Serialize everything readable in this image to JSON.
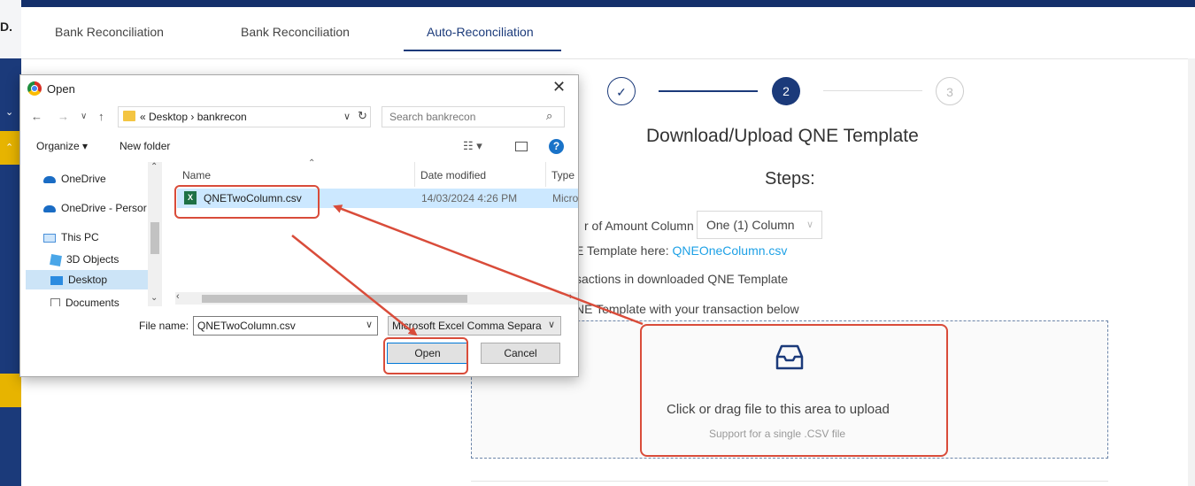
{
  "app": {
    "brand_initial": "D."
  },
  "tabs": [
    {
      "label": "Bank Reconciliation"
    },
    {
      "label": "Bank Reconciliation"
    },
    {
      "label": "Auto-Reconciliation"
    }
  ],
  "stepper": {
    "step2": "2",
    "step3": "3"
  },
  "main": {
    "heading": "Download/Upload QNE Template",
    "steps_label": "Steps:",
    "line1": "r of Amount Column",
    "select_value": "One (1) Column",
    "line2_prefix": "E Template here: ",
    "line2_link": "QNEOneColumn.csv",
    "line3": "sactions in downloaded QNE Template",
    "line4": "NE Template with your transaction below",
    "upload_text": "Click or drag file to this area to upload",
    "upload_hint": "Support for a single .CSV file"
  },
  "dialog": {
    "title": "Open",
    "address": "« Desktop › bankrecon",
    "search_placeholder": "Search bankrecon",
    "organize_label": "Organize ▾",
    "new_folder_label": "New folder",
    "nav_items": [
      {
        "label": "OneDrive"
      },
      {
        "label": "OneDrive - Persor"
      },
      {
        "label": "This PC"
      },
      {
        "label": "3D Objects"
      },
      {
        "label": "Desktop"
      },
      {
        "label": "Documents"
      }
    ],
    "columns": {
      "name": "Name",
      "date": "Date modified",
      "type": "Type"
    },
    "file": {
      "name": "QNETwoColumn.csv",
      "date": "14/03/2024 4:26 PM",
      "type": "Micro"
    },
    "file_name_label": "File name:",
    "file_name_value": "QNETwoColumn.csv",
    "file_type_value": "Microsoft Excel Comma Separa",
    "open_button": "Open",
    "cancel_button": "Cancel"
  },
  "colors": {
    "primary": "#1b3a7a",
    "accent_yellow": "#e7b400",
    "annotation_red": "#d94c3a",
    "link": "#1ea1e6"
  }
}
